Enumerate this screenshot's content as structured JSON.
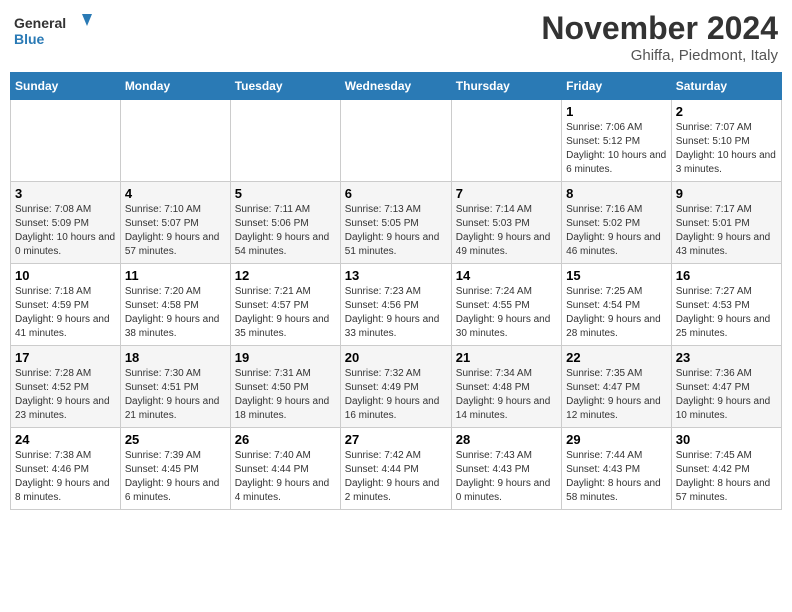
{
  "header": {
    "logo_line1": "General",
    "logo_line2": "Blue",
    "month": "November 2024",
    "location": "Ghiffa, Piedmont, Italy"
  },
  "columns": [
    "Sunday",
    "Monday",
    "Tuesday",
    "Wednesday",
    "Thursday",
    "Friday",
    "Saturday"
  ],
  "weeks": [
    [
      {
        "day": "",
        "info": ""
      },
      {
        "day": "",
        "info": ""
      },
      {
        "day": "",
        "info": ""
      },
      {
        "day": "",
        "info": ""
      },
      {
        "day": "",
        "info": ""
      },
      {
        "day": "1",
        "info": "Sunrise: 7:06 AM\nSunset: 5:12 PM\nDaylight: 10 hours and 6 minutes."
      },
      {
        "day": "2",
        "info": "Sunrise: 7:07 AM\nSunset: 5:10 PM\nDaylight: 10 hours and 3 minutes."
      }
    ],
    [
      {
        "day": "3",
        "info": "Sunrise: 7:08 AM\nSunset: 5:09 PM\nDaylight: 10 hours and 0 minutes."
      },
      {
        "day": "4",
        "info": "Sunrise: 7:10 AM\nSunset: 5:07 PM\nDaylight: 9 hours and 57 minutes."
      },
      {
        "day": "5",
        "info": "Sunrise: 7:11 AM\nSunset: 5:06 PM\nDaylight: 9 hours and 54 minutes."
      },
      {
        "day": "6",
        "info": "Sunrise: 7:13 AM\nSunset: 5:05 PM\nDaylight: 9 hours and 51 minutes."
      },
      {
        "day": "7",
        "info": "Sunrise: 7:14 AM\nSunset: 5:03 PM\nDaylight: 9 hours and 49 minutes."
      },
      {
        "day": "8",
        "info": "Sunrise: 7:16 AM\nSunset: 5:02 PM\nDaylight: 9 hours and 46 minutes."
      },
      {
        "day": "9",
        "info": "Sunrise: 7:17 AM\nSunset: 5:01 PM\nDaylight: 9 hours and 43 minutes."
      }
    ],
    [
      {
        "day": "10",
        "info": "Sunrise: 7:18 AM\nSunset: 4:59 PM\nDaylight: 9 hours and 41 minutes."
      },
      {
        "day": "11",
        "info": "Sunrise: 7:20 AM\nSunset: 4:58 PM\nDaylight: 9 hours and 38 minutes."
      },
      {
        "day": "12",
        "info": "Sunrise: 7:21 AM\nSunset: 4:57 PM\nDaylight: 9 hours and 35 minutes."
      },
      {
        "day": "13",
        "info": "Sunrise: 7:23 AM\nSunset: 4:56 PM\nDaylight: 9 hours and 33 minutes."
      },
      {
        "day": "14",
        "info": "Sunrise: 7:24 AM\nSunset: 4:55 PM\nDaylight: 9 hours and 30 minutes."
      },
      {
        "day": "15",
        "info": "Sunrise: 7:25 AM\nSunset: 4:54 PM\nDaylight: 9 hours and 28 minutes."
      },
      {
        "day": "16",
        "info": "Sunrise: 7:27 AM\nSunset: 4:53 PM\nDaylight: 9 hours and 25 minutes."
      }
    ],
    [
      {
        "day": "17",
        "info": "Sunrise: 7:28 AM\nSunset: 4:52 PM\nDaylight: 9 hours and 23 minutes."
      },
      {
        "day": "18",
        "info": "Sunrise: 7:30 AM\nSunset: 4:51 PM\nDaylight: 9 hours and 21 minutes."
      },
      {
        "day": "19",
        "info": "Sunrise: 7:31 AM\nSunset: 4:50 PM\nDaylight: 9 hours and 18 minutes."
      },
      {
        "day": "20",
        "info": "Sunrise: 7:32 AM\nSunset: 4:49 PM\nDaylight: 9 hours and 16 minutes."
      },
      {
        "day": "21",
        "info": "Sunrise: 7:34 AM\nSunset: 4:48 PM\nDaylight: 9 hours and 14 minutes."
      },
      {
        "day": "22",
        "info": "Sunrise: 7:35 AM\nSunset: 4:47 PM\nDaylight: 9 hours and 12 minutes."
      },
      {
        "day": "23",
        "info": "Sunrise: 7:36 AM\nSunset: 4:47 PM\nDaylight: 9 hours and 10 minutes."
      }
    ],
    [
      {
        "day": "24",
        "info": "Sunrise: 7:38 AM\nSunset: 4:46 PM\nDaylight: 9 hours and 8 minutes."
      },
      {
        "day": "25",
        "info": "Sunrise: 7:39 AM\nSunset: 4:45 PM\nDaylight: 9 hours and 6 minutes."
      },
      {
        "day": "26",
        "info": "Sunrise: 7:40 AM\nSunset: 4:44 PM\nDaylight: 9 hours and 4 minutes."
      },
      {
        "day": "27",
        "info": "Sunrise: 7:42 AM\nSunset: 4:44 PM\nDaylight: 9 hours and 2 minutes."
      },
      {
        "day": "28",
        "info": "Sunrise: 7:43 AM\nSunset: 4:43 PM\nDaylight: 9 hours and 0 minutes."
      },
      {
        "day": "29",
        "info": "Sunrise: 7:44 AM\nSunset: 4:43 PM\nDaylight: 8 hours and 58 minutes."
      },
      {
        "day": "30",
        "info": "Sunrise: 7:45 AM\nSunset: 4:42 PM\nDaylight: 8 hours and 57 minutes."
      }
    ]
  ]
}
